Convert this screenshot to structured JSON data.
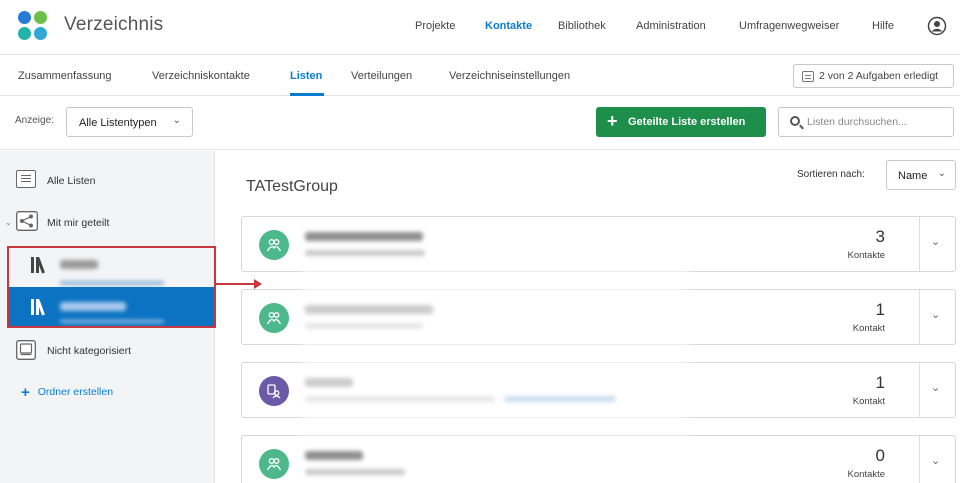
{
  "header": {
    "app_title": "Verzeichnis",
    "nav": [
      "Projekte",
      "Kontakte",
      "Bibliothek",
      "Administration",
      "Umfragenwegweiser",
      "Hilfe"
    ],
    "active_nav": "Kontakte"
  },
  "subnav": {
    "tabs": [
      "Zusammenfassung",
      "Verzeichniskontakte",
      "Listen",
      "Verteilungen",
      "Verzeichniseinstellungen"
    ],
    "active_tab": "Listen",
    "tasks": "2 von 2 Aufgaben erledigt"
  },
  "toolbar": {
    "anzeige_label": "Anzeige:",
    "filter_value": "Alle Listentypen",
    "create_button": "Geteilte Liste erstellen",
    "search_placeholder": "Listen durchsuchen..."
  },
  "sidebar": {
    "all_lists": "Alle Listen",
    "shared_with_me": "Mit mir geteilt",
    "uncategorized": "Nicht kategorisiert",
    "create_folder": "Ordner erstellen"
  },
  "main": {
    "group_title": "TATestGroup",
    "sort_label": "Sortieren nach:",
    "sort_value": "Name",
    "cards": [
      {
        "count": "3",
        "unit": "Kontakte",
        "avatar_color": "#4db88c"
      },
      {
        "count": "1",
        "unit": "Kontakt",
        "avatar_color": "#4db88c"
      },
      {
        "count": "1",
        "unit": "Kontakt",
        "avatar_color": "#6a5aa8"
      },
      {
        "count": "0",
        "unit": "Kontakte",
        "avatar_color": "#4db88c"
      }
    ]
  },
  "colors": {
    "accent": "#0b7dd1",
    "create_button": "#1d8f4a",
    "highlight": "#c8373e",
    "selected_row": "#0b73c2"
  },
  "icons": [
    "logo-dots",
    "user-icon",
    "task-icon",
    "chevron-down-icon",
    "plus-icon",
    "search-icon",
    "list-icon",
    "share-icon",
    "library-icon",
    "tray-icon",
    "contacts-icon",
    "arrow-right-icon"
  ]
}
